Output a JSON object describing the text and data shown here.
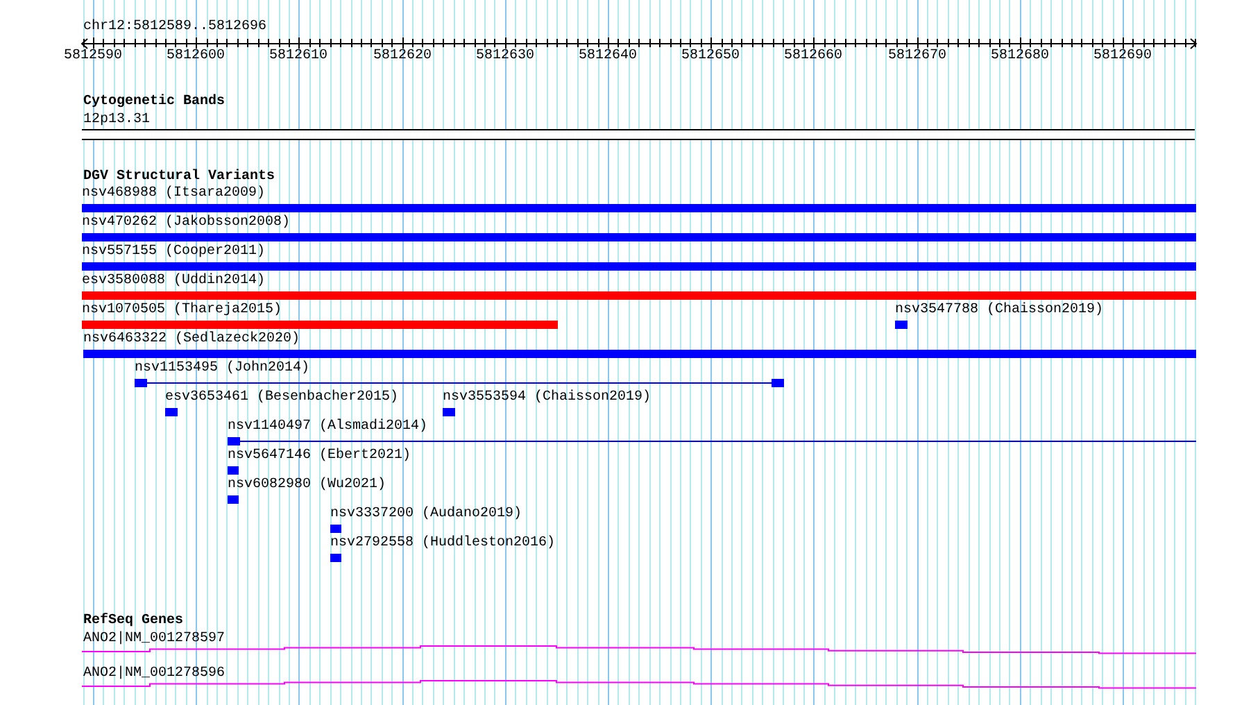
{
  "location": "chr12:5812589..5812696",
  "ruler": {
    "ticks": [
      "5812590",
      "5812600",
      "5812610",
      "5812620",
      "5812630",
      "5812640",
      "5812650",
      "5812660",
      "5812670",
      "5812680",
      "5812690"
    ]
  },
  "tracks": [
    {
      "kind": "bands",
      "title": "Cytogenetic Bands",
      "features": [
        {
          "label": "12p13.31"
        }
      ]
    },
    {
      "kind": "variants",
      "title": "DGV Structural Variants",
      "features": [
        {
          "label": "nsv468988 (Itsara2009)",
          "color": "#0000ff"
        },
        {
          "label": "nsv470262 (Jakobsson2008)",
          "color": "#0000ff"
        },
        {
          "label": "nsv557155 (Cooper2011)",
          "color": "#0000ff"
        },
        {
          "label": "esv3580088 (Uddin2014)",
          "color": "#ff0000"
        },
        {
          "label": "nsv1070505 (Thareja2015)",
          "color": "#ff0000"
        },
        {
          "label": "nsv3547788 (Chaisson2019)",
          "color": "#0000ff"
        },
        {
          "label": "nsv6463322 (Sedlazeck2020)",
          "color": "#0000ff"
        },
        {
          "label": "nsv1153495 (John2014)",
          "color": "#0000ff"
        },
        {
          "label": "esv3653461 (Besenbacher2015)",
          "color": "#0000ff"
        },
        {
          "label": "nsv3553594 (Chaisson2019)",
          "color": "#0000ff"
        },
        {
          "label": "nsv1140497 (Alsmadi2014)",
          "color": "#0000ff"
        },
        {
          "label": "nsv5647146 (Ebert2021)",
          "color": "#0000ff"
        },
        {
          "label": "nsv6082980 (Wu2021)",
          "color": "#0000ff"
        },
        {
          "label": "nsv3337200 (Audano2019)",
          "color": "#0000ff"
        },
        {
          "label": "nsv2792558 (Huddleston2016)",
          "color": "#0000ff"
        }
      ]
    },
    {
      "kind": "genes",
      "title": "RefSeq Genes",
      "features": [
        {
          "label": "ANO2|NM_001278597"
        },
        {
          "label": "ANO2|NM_001278596"
        }
      ]
    }
  ]
}
